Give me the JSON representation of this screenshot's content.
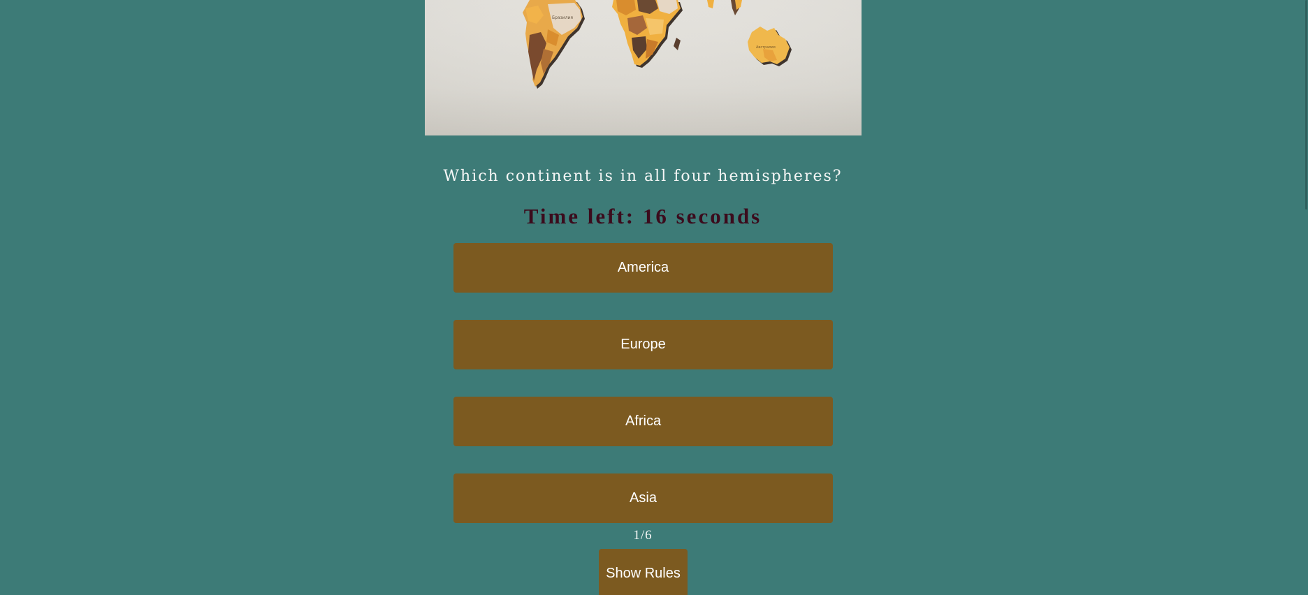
{
  "quiz": {
    "question": "Which continent is in all four hemispheres?",
    "timer_text": "Time left: 16 seconds",
    "answers": [
      "America",
      "Europe",
      "Africa",
      "Asia"
    ],
    "progress": "1/6",
    "rules_label": "Show Rules"
  },
  "hero_image": {
    "map_labels": [
      "Бразилия",
      "Австралия"
    ]
  },
  "colors": {
    "page_background": "#3d7b77",
    "button_background": "#7c5a20",
    "button_text": "#ffffff",
    "question_text": "#f4f6f5",
    "timer_text": "#3b0b1c"
  }
}
